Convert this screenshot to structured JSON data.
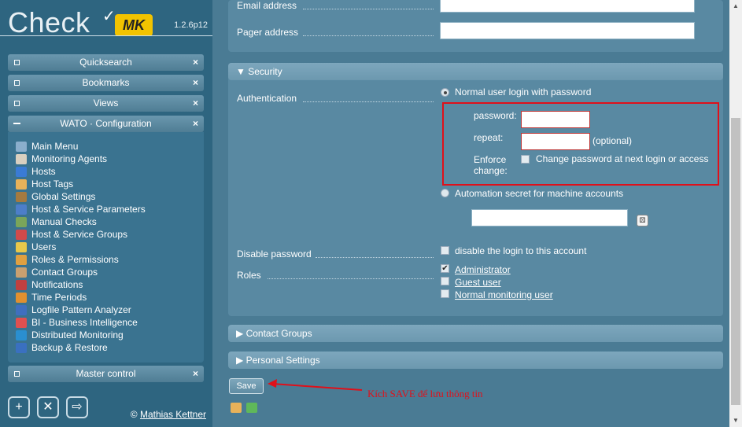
{
  "logo": {
    "brand": "Check",
    "mk": "MK",
    "version": "1.2.6p12"
  },
  "sidebar": {
    "snapins": [
      {
        "title": "Quicksearch"
      },
      {
        "title": "Bookmarks"
      },
      {
        "title": "Views"
      },
      {
        "title": "WATO · Configuration"
      },
      {
        "title": "Master control"
      }
    ],
    "close_glyph": "×",
    "wato_items": [
      {
        "label": "Main Menu",
        "color": "#8aaecc"
      },
      {
        "label": "Monitoring Agents",
        "color": "#d9d0c0"
      },
      {
        "label": "Hosts",
        "color": "#3a7bd5"
      },
      {
        "label": "Host Tags",
        "color": "#e8b25a"
      },
      {
        "label": "Global Settings",
        "color": "#a57a3f"
      },
      {
        "label": "Host & Service Parameters",
        "color": "#4d7ec9"
      },
      {
        "label": "Manual Checks",
        "color": "#7aa55a"
      },
      {
        "label": "Host & Service Groups",
        "color": "#d04a4a"
      },
      {
        "label": "Users",
        "color": "#e8c84a"
      },
      {
        "label": "Roles & Permissions",
        "color": "#e0a040"
      },
      {
        "label": "Contact Groups",
        "color": "#c8a070"
      },
      {
        "label": "Notifications",
        "color": "#c04040"
      },
      {
        "label": "Time Periods",
        "color": "#e09030"
      },
      {
        "label": "Logfile Pattern Analyzer",
        "color": "#3f6fbf"
      },
      {
        "label": "BI - Business Intelligence",
        "color": "#e05050"
      },
      {
        "label": "Distributed Monitoring",
        "color": "#2a8fd0"
      },
      {
        "label": "Backup & Restore",
        "color": "#3a70c0"
      }
    ],
    "author_prefix": "©",
    "author_name": "Mathias Kettner"
  },
  "form": {
    "email_label": "Email address",
    "pager_label": "Pager address",
    "security_title": "Security",
    "authentication_label": "Authentication",
    "auth_option_password": "Normal user login with password",
    "password_label": "password:",
    "repeat_label": "repeat:",
    "optional_text": "(optional)",
    "enforce_label_1": "Enforce",
    "enforce_label_2": "change:",
    "enforce_text": "Change password at next login or access",
    "auth_option_automation": "Automation secret for machine accounts",
    "disable_password_label": "Disable password",
    "disable_text": "disable the login to this account",
    "roles_label": "Roles",
    "roles": [
      {
        "label": "Administrator",
        "checked": "✔"
      },
      {
        "label": "Guest user",
        "checked": ""
      },
      {
        "label": "Normal monitoring user",
        "checked": ""
      }
    ],
    "contact_groups_title": "Contact Groups",
    "personal_settings_title": "Personal Settings",
    "save_label": "Save",
    "annotation": "Kích SAVE để lưu thông tin"
  },
  "colors": {
    "highlight": "#e0101a",
    "accent": "#f2c300"
  }
}
